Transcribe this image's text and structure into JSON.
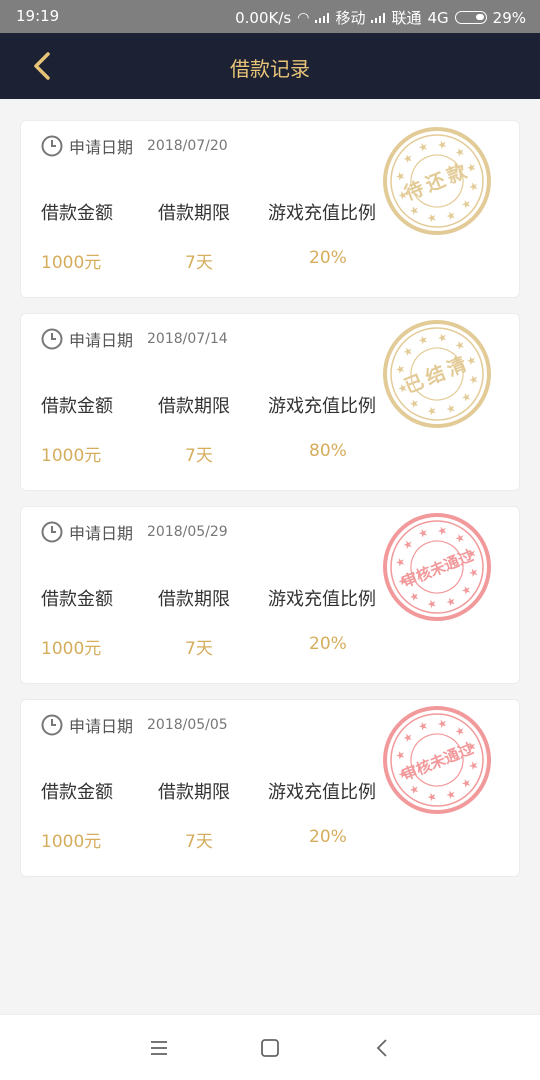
{
  "status": {
    "time": "19:19",
    "speed": "0.00K/s",
    "carrier1": "移动",
    "carrier2": "联通",
    "network": "4G",
    "battery": "29%"
  },
  "header": {
    "title": "借款记录"
  },
  "labels": {
    "date_label": "申请日期",
    "amount_label": "借款金额",
    "term_label": "借款期限",
    "ratio_label": "游戏充值比例"
  },
  "records": [
    {
      "date": "2018/07/20",
      "amount": "1000元",
      "term": "7天",
      "ratio": "20%",
      "stamp": "待还款",
      "stamp_color": "#e3cb97"
    },
    {
      "date": "2018/07/14",
      "amount": "1000元",
      "term": "7天",
      "ratio": "80%",
      "stamp": "已结清",
      "stamp_color": "#e3cb97"
    },
    {
      "date": "2018/05/29",
      "amount": "1000元",
      "term": "7天",
      "ratio": "20%",
      "stamp": "审核未通过",
      "stamp_color": "#f2999b"
    },
    {
      "date": "2018/05/05",
      "amount": "1000元",
      "term": "7天",
      "ratio": "20%",
      "stamp": "审核未通过",
      "stamp_color": "#f2999b"
    }
  ],
  "colors": {
    "navbar": "#1c2233",
    "accent": "#e8c478",
    "value": "#d6ad5c"
  }
}
